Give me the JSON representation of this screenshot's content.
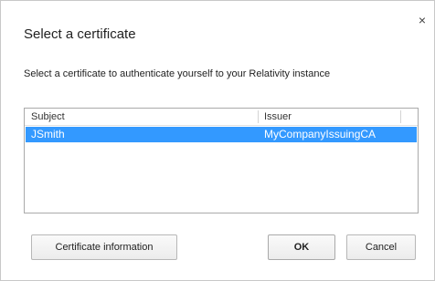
{
  "dialog": {
    "title": "Select a certificate",
    "close_glyph": "×",
    "subtitle": "Select a certificate to authenticate yourself to your Relativity instance"
  },
  "table": {
    "columns": [
      "Subject",
      "Issuer"
    ],
    "rows": [
      {
        "subject": "JSmith",
        "issuer": "MyCompanyIssuingCA",
        "selected": true
      }
    ]
  },
  "buttons": {
    "cert_info": "Certificate information",
    "ok": "OK",
    "cancel": "Cancel"
  },
  "colors": {
    "selection": "#3399ff",
    "selection_text": "#ffffff"
  }
}
